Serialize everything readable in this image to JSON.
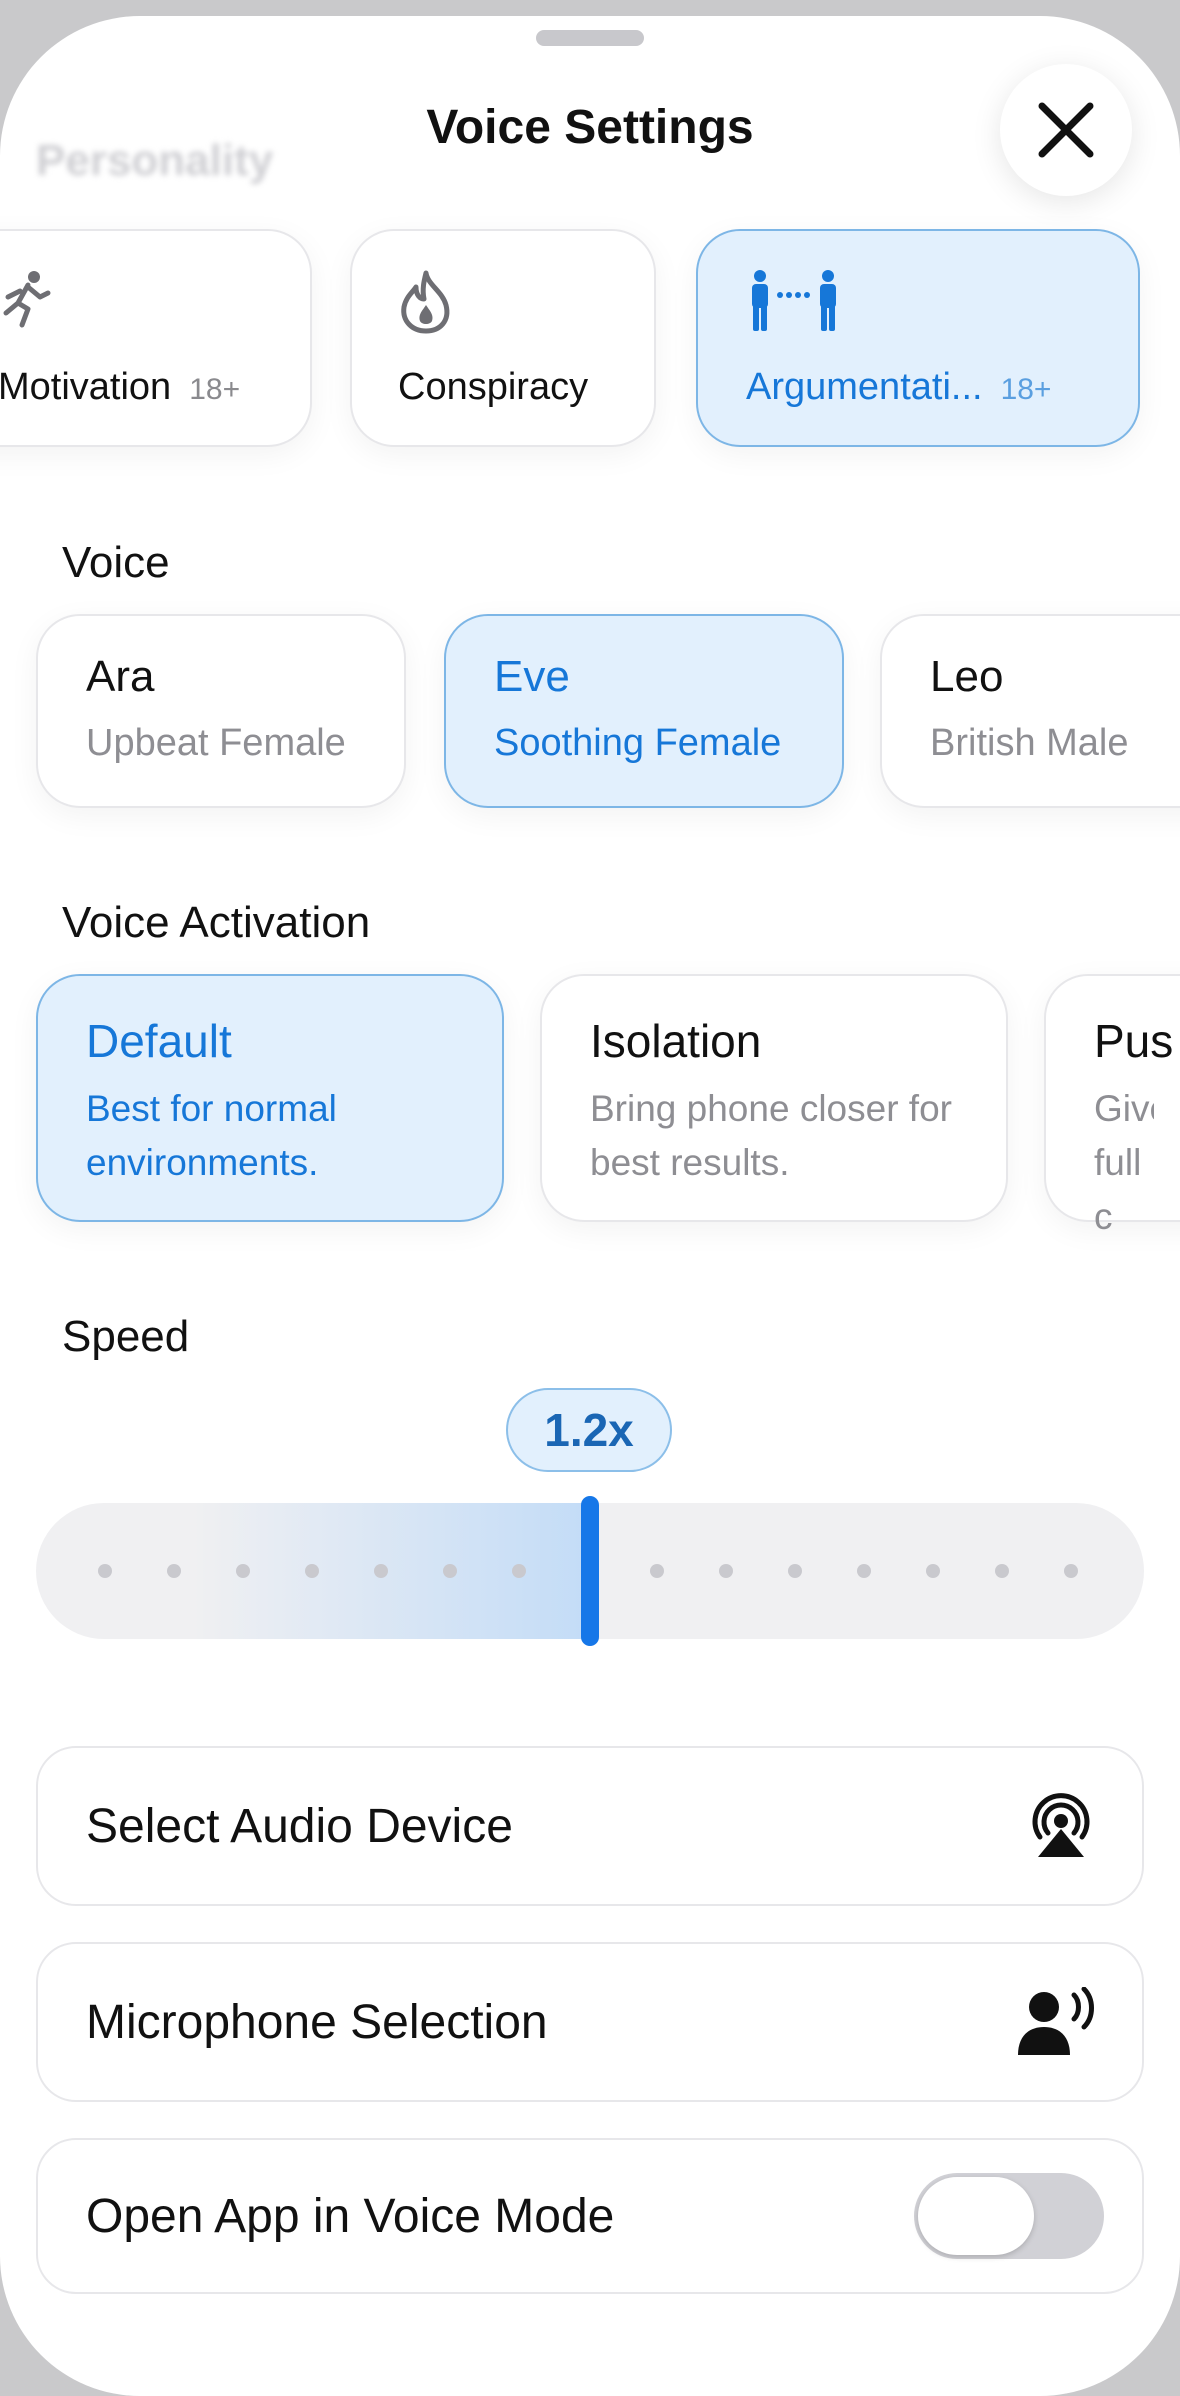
{
  "header": {
    "background_label": "Personality",
    "title": "Voice Settings"
  },
  "personality": {
    "items": [
      {
        "label": "Motivation",
        "badge": "18+",
        "icon": "running-person-icon",
        "selected": false
      },
      {
        "label": "Conspiracy",
        "badge": "",
        "icon": "flame-icon",
        "selected": false
      },
      {
        "label": "Argumentati...",
        "badge": "18+",
        "icon": "two-people-icon",
        "selected": true
      }
    ]
  },
  "voice": {
    "title": "Voice",
    "items": [
      {
        "name": "Ara",
        "desc": "Upbeat Female",
        "selected": false
      },
      {
        "name": "Eve",
        "desc": "Soothing Female",
        "selected": true
      },
      {
        "name": "Leo",
        "desc": "British Male",
        "selected": false
      }
    ]
  },
  "activation": {
    "title": "Voice Activation",
    "items": [
      {
        "name": "Default",
        "desc": "Best for normal environments.",
        "selected": true
      },
      {
        "name": "Isolation",
        "desc": "Bring phone closer for best results.",
        "selected": false
      },
      {
        "name": "Pus",
        "desc": "Gives full c",
        "selected": false
      }
    ]
  },
  "speed": {
    "title": "Speed",
    "value_label": "1.2x",
    "position_fraction": 0.5
  },
  "rows": [
    {
      "label": "Select Audio Device",
      "icon": "airplay-audio-icon"
    },
    {
      "label": "Microphone Selection",
      "icon": "person-speaking-icon"
    },
    {
      "label": "Open App in Voice Mode",
      "icon": "toggle-switch",
      "toggle_on": false
    }
  ],
  "colors": {
    "accent": "#1677d8",
    "selected_bg": "#e2f0fd"
  }
}
